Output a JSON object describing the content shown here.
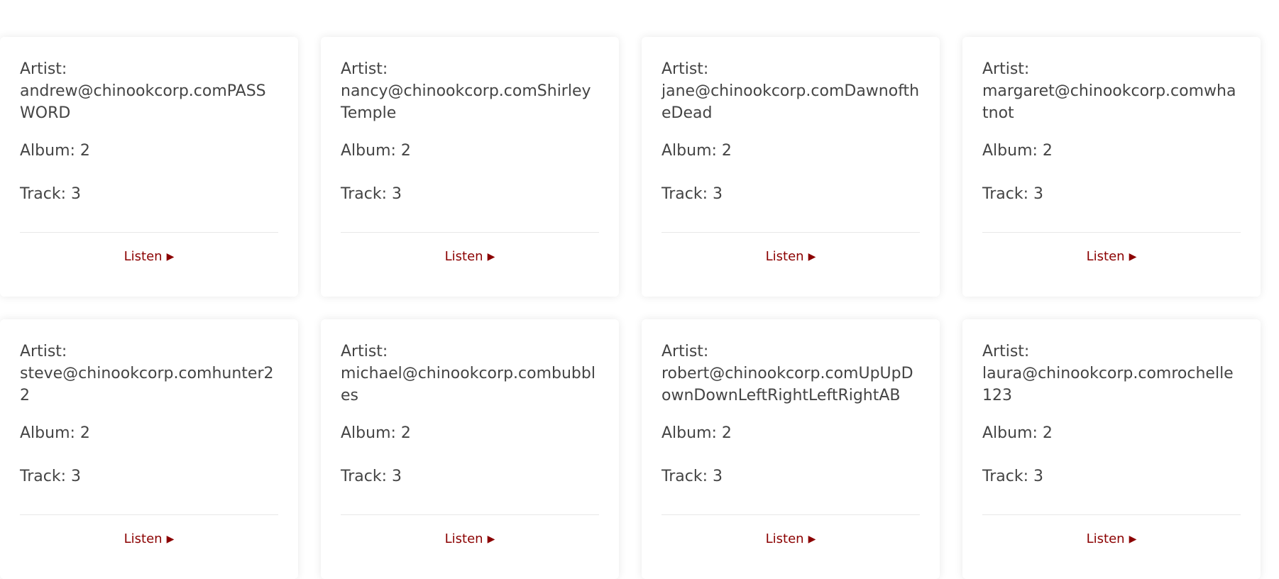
{
  "cards": [
    {
      "artist_label": "Artist:",
      "artist": "andrew@chinookcorp.comPASSWORD",
      "album_label": "Album:",
      "album": "2",
      "track_label": "Track:",
      "track": "3",
      "listen_label": "Listen",
      "listen_icon": "play-icon"
    },
    {
      "artist_label": "Artist:",
      "artist": "nancy@chinookcorp.comShirley Temple",
      "album_label": "Album:",
      "album": "2",
      "track_label": "Track:",
      "track": "3",
      "listen_label": "Listen",
      "listen_icon": "play-icon"
    },
    {
      "artist_label": "Artist:",
      "artist": "jane@chinookcorp.comDawnoftheDead",
      "album_label": "Album:",
      "album": "2",
      "track_label": "Track:",
      "track": "3",
      "listen_label": "Listen",
      "listen_icon": "play-icon"
    },
    {
      "artist_label": "Artist:",
      "artist": "margaret@chinookcorp.comwhatnot",
      "album_label": "Album:",
      "album": "2",
      "track_label": "Track:",
      "track": "3",
      "listen_label": "Listen",
      "listen_icon": "play-icon"
    },
    {
      "artist_label": "Artist:",
      "artist": "steve@chinookcorp.comhunter22",
      "album_label": "Album:",
      "album": "2",
      "track_label": "Track:",
      "track": "3",
      "listen_label": "Listen",
      "listen_icon": "play-icon"
    },
    {
      "artist_label": "Artist:",
      "artist": "michael@chinookcorp.combubbles",
      "album_label": "Album:",
      "album": "2",
      "track_label": "Track:",
      "track": "3",
      "listen_label": "Listen",
      "listen_icon": "play-icon"
    },
    {
      "artist_label": "Artist:",
      "artist": "robert@chinookcorp.comUpUpDownDownLeftRightLeftRightAB",
      "album_label": "Album:",
      "album": "2",
      "track_label": "Track:",
      "track": "3",
      "listen_label": "Listen",
      "listen_icon": "play-icon"
    },
    {
      "artist_label": "Artist:",
      "artist": "laura@chinookcorp.comrochelle123",
      "album_label": "Album:",
      "album": "2",
      "track_label": "Track:",
      "track": "3",
      "listen_label": "Listen",
      "listen_icon": "play-icon"
    }
  ],
  "colors": {
    "accent": "#8b0000",
    "text": "#444444",
    "divider": "#e8e8e8",
    "background": "#ffffff"
  }
}
